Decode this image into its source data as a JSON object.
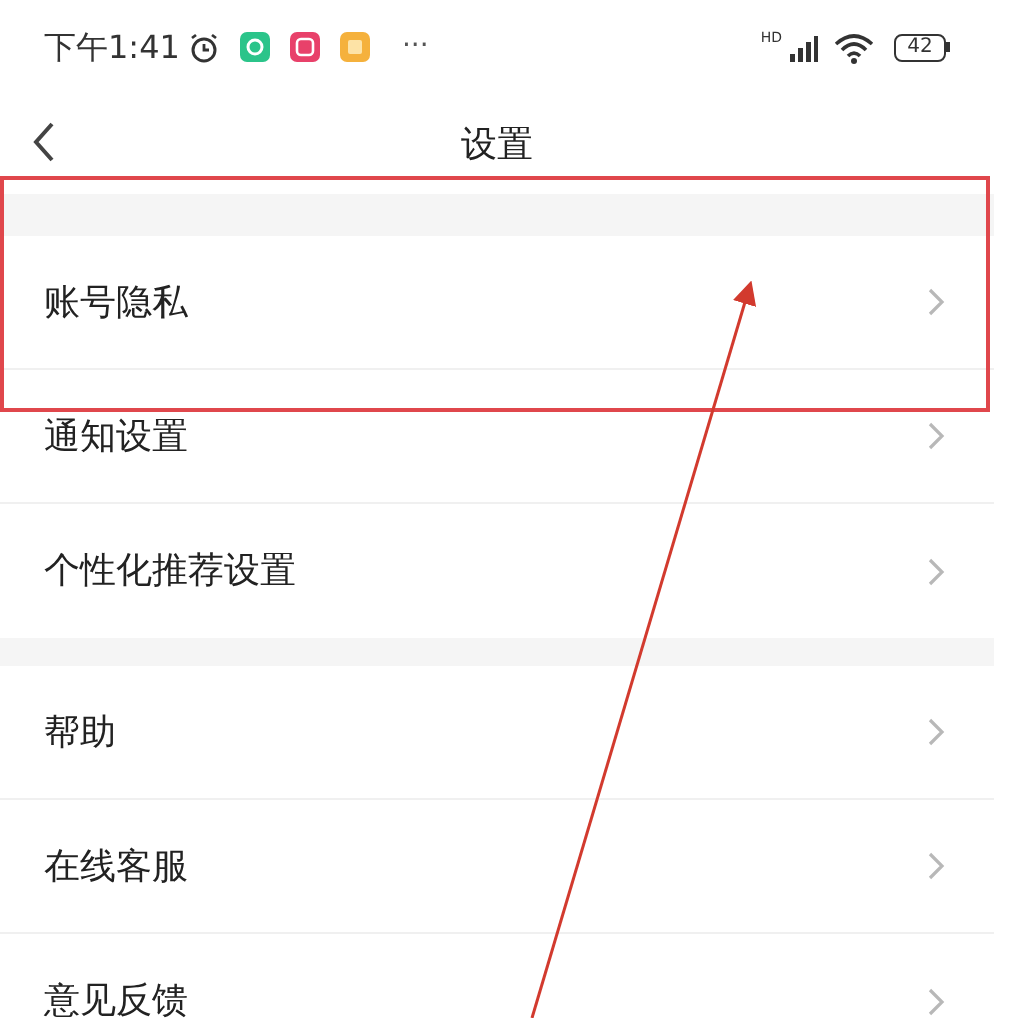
{
  "status_bar": {
    "time": "下午1:41",
    "more": "···",
    "network": "HD",
    "battery": "42"
  },
  "header": {
    "title": "设置"
  },
  "sections": [
    {
      "items": [
        {
          "label": "账号隐私"
        },
        {
          "label": "通知设置"
        },
        {
          "label": "个性化推荐设置"
        }
      ]
    },
    {
      "items": [
        {
          "label": "帮助"
        },
        {
          "label": "在线客服"
        },
        {
          "label": "意见反馈"
        }
      ]
    }
  ]
}
